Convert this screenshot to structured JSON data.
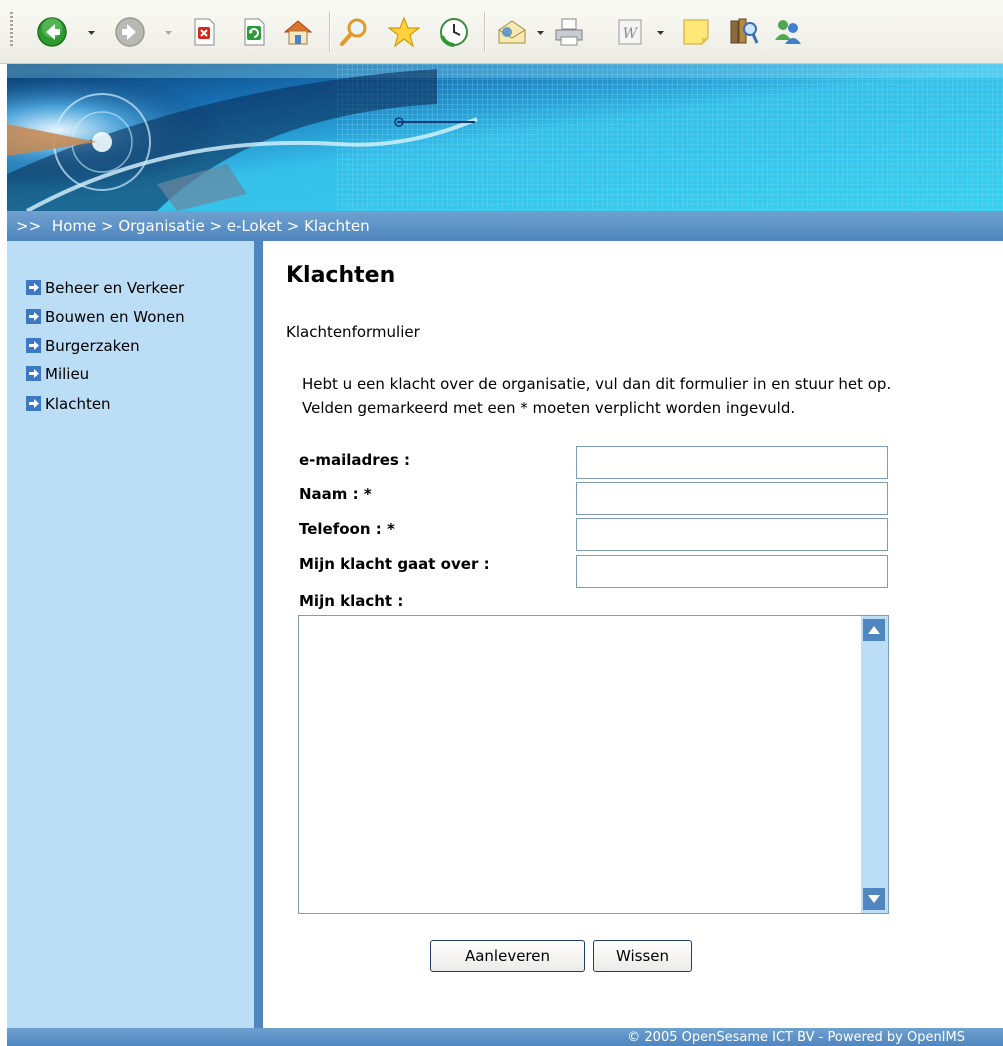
{
  "toolbar": {
    "buttons": [
      "back-icon",
      "forward-icon",
      "stop-icon",
      "refresh-icon",
      "home-icon",
      "search-icon",
      "favorites-icon",
      "history-icon",
      "mail-icon",
      "print-icon",
      "word-icon",
      "note-icon",
      "research-icon",
      "messenger-icon"
    ]
  },
  "breadcrumb": {
    "prefix": ">>",
    "trail": "Home > Organisatie > e-Loket > Klachten"
  },
  "sidebar": {
    "items": [
      {
        "label": "Beheer en Verkeer"
      },
      {
        "label": "Bouwen en Wonen"
      },
      {
        "label": "Burgerzaken"
      },
      {
        "label": "Milieu"
      },
      {
        "label": "Klachten"
      }
    ]
  },
  "main": {
    "title": "Klachten",
    "subtitle": "Klachtenformulier",
    "intro_line1": "Hebt u een klacht over de organisatie, vul dan dit formulier in en stuur het op.",
    "intro_line2": "Velden gemarkeerd met een * moeten verplicht worden ingevuld."
  },
  "form": {
    "email_label": "e-mailadres :",
    "name_label": "Naam : *",
    "phone_label": "Telefoon : *",
    "subject_label": "Mijn klacht gaat over :",
    "complaint_label": "Mijn klacht :",
    "email_value": "",
    "name_value": "",
    "phone_value": "",
    "subject_value": "",
    "complaint_value": "",
    "submit_label": "Aanleveren",
    "reset_label": "Wissen"
  },
  "footer": {
    "text": "© 2005 OpenSesame ICT BV - Powered by OpenIMS"
  },
  "colors": {
    "accent_blue": "#4f86bf",
    "sidebar_bg": "#bcddf6",
    "toolbar_bg": "#ecebe3"
  }
}
